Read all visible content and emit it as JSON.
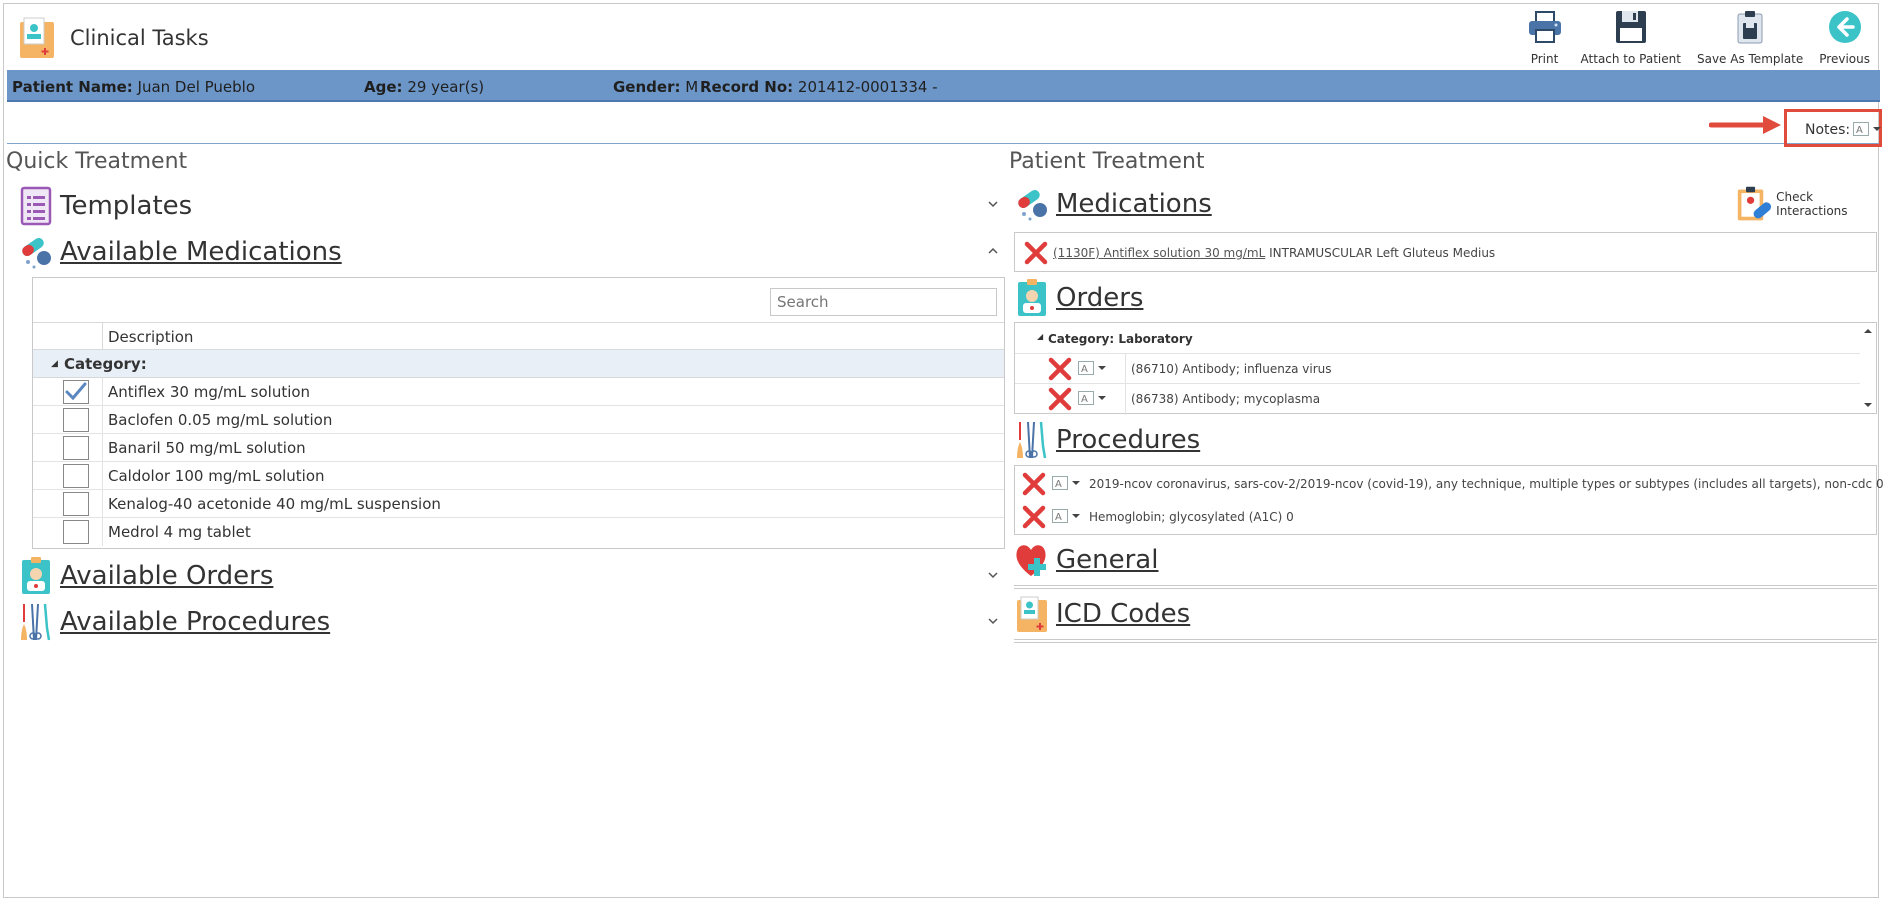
{
  "app": {
    "title": "Clinical Tasks"
  },
  "toolbar": {
    "print": "Print",
    "attach": "Attach to Patient",
    "save_template": "Save As Template",
    "previous": "Previous"
  },
  "patient": {
    "name_label": "Patient Name:",
    "name": "Juan Del Pueblo",
    "age_label": "Age:",
    "age": "29 year(s)",
    "gender_label": "Gender:",
    "gender": "M",
    "record_label": "Record No:",
    "record": "201412-0001334 -"
  },
  "notes": {
    "label": "Notes:"
  },
  "quick_treatment": {
    "title": "Quick Treatment",
    "templates_label": "Templates",
    "available_medications_label": "Available Medications",
    "search_placeholder": "Search",
    "column_description": "Description",
    "category_label": "Category:",
    "medications": [
      {
        "name": "Antiflex 30 mg/mL solution",
        "checked": true
      },
      {
        "name": "Baclofen 0.05 mg/mL solution",
        "checked": false
      },
      {
        "name": "Banaril 50 mg/mL solution",
        "checked": false
      },
      {
        "name": "Caldolor 100 mg/mL solution",
        "checked": false
      },
      {
        "name": "Kenalog-40 acetonide 40 mg/mL suspension",
        "checked": false
      },
      {
        "name": "Medrol 4 mg tablet",
        "checked": false
      }
    ],
    "available_orders_label": "Available Orders",
    "available_procedures_label": "Available Procedures"
  },
  "patient_treatment": {
    "title": "Patient Treatment",
    "medications_label": "Medications",
    "check_interactions": "Check Interactions",
    "medication_item": {
      "link": "(1130F) Antiflex solution 30 mg/mL",
      "detail": "INTRAMUSCULAR Left Gluteus Medius"
    },
    "orders_label": "Orders",
    "orders_category": "Category: Laboratory",
    "orders": [
      "(86710) Antibody; influenza virus",
      "(86738) Antibody; mycoplasma"
    ],
    "procedures_label": "Procedures",
    "procedures": [
      "2019-ncov coronavirus, sars-cov-2/2019-ncov (covid-19), any technique, multiple types or subtypes (includes all targets), non-cdc 0",
      "Hemoglobin; glycosylated (A1C) 0"
    ],
    "general_label": "General",
    "icd_label": "ICD Codes"
  },
  "colors": {
    "patient_bar": "#6c96c8",
    "remove_red": "#e03c3c",
    "highlight_red": "#e04b3c",
    "accent_teal": "#3cc3c8"
  },
  "icons": {
    "app": "clinical-folder-icon",
    "print": "printer-icon",
    "attach": "floppy-disk-icon",
    "save_template": "clipboard-save-icon",
    "previous": "back-arrow-icon"
  }
}
